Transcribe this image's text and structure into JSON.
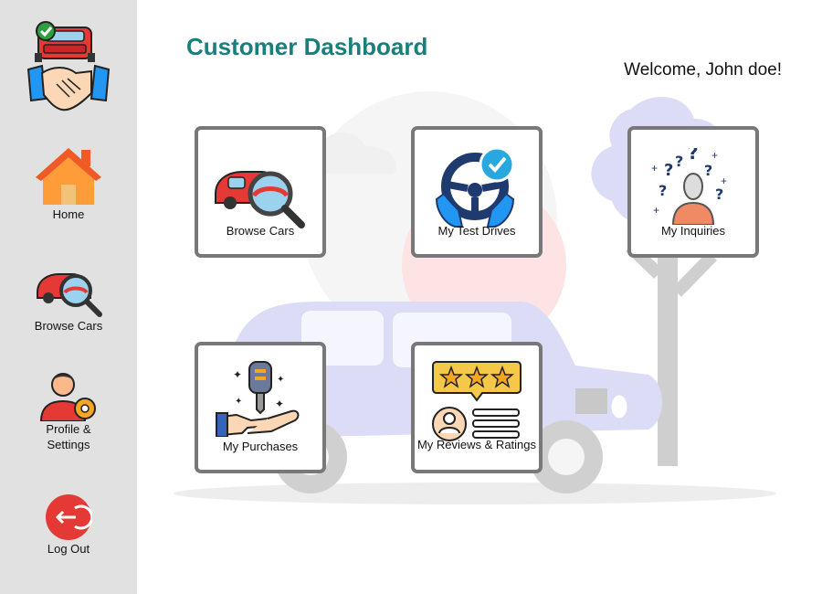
{
  "sidebar": {
    "logo_icon": "car-handshake-logo",
    "items": [
      {
        "label": "Home",
        "icon": "home-icon"
      },
      {
        "label": "Browse Cars",
        "icon": "car-search-icon"
      },
      {
        "label": "Profile & Settings",
        "icon": "profile-gear-icon"
      },
      {
        "label": "Log Out",
        "icon": "logout-icon"
      }
    ]
  },
  "header": {
    "title": "Customer Dashboard",
    "welcome": "Welcome, John doe!"
  },
  "cards": [
    {
      "label": "Browse Cars",
      "icon": "car-search-icon"
    },
    {
      "label": "My Test Drives",
      "icon": "steering-wheel-check-icon"
    },
    {
      "label": "My Inquiries",
      "icon": "question-person-icon"
    },
    {
      "label": "My Purchases",
      "icon": "car-key-hand-icon"
    },
    {
      "label": "My Reviews & Ratings",
      "icon": "stars-review-icon"
    }
  ],
  "colors": {
    "sidebar_bg": "#e1e1e1",
    "title": "#1a7f7a",
    "card_border": "#787878",
    "logout_red": "#e53935",
    "illustration_lavender": "#dcdcf7",
    "illustration_pink": "#fde3e3"
  }
}
